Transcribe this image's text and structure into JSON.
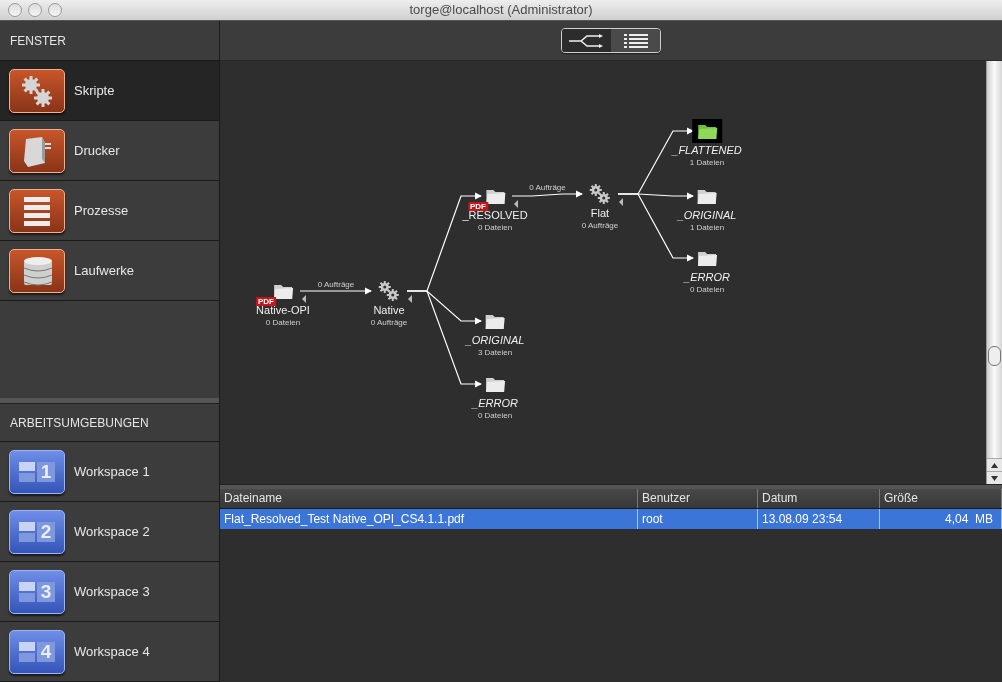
{
  "window": {
    "title": "torge@localhost (Administrator)"
  },
  "sidebar": {
    "sections": [
      {
        "title": "FENSTER",
        "items": [
          {
            "label": "Skripte",
            "kind": "gears",
            "selected": true
          },
          {
            "label": "Drucker",
            "kind": "printer",
            "selected": false
          },
          {
            "label": "Prozesse",
            "kind": "list",
            "selected": false
          },
          {
            "label": "Laufwerke",
            "kind": "disks",
            "selected": false
          }
        ]
      },
      {
        "title": "ARBEITSUMGEBUNGEN",
        "items": [
          {
            "label": "Workspace 1",
            "kind": "workspace",
            "badge": "1",
            "selected": false
          },
          {
            "label": "Workspace 2",
            "kind": "workspace",
            "badge": "2",
            "selected": false
          },
          {
            "label": "Workspace 3",
            "kind": "workspace",
            "badge": "3",
            "selected": false
          },
          {
            "label": "Workspace 4",
            "kind": "workspace",
            "badge": "4",
            "selected": false
          }
        ]
      }
    ]
  },
  "view_switch": [
    {
      "kind": "workflow",
      "selected": true
    },
    {
      "kind": "list",
      "selected": false
    }
  ],
  "workflow": {
    "kind": "folder",
    "name": "Native-OPI",
    "count": "0 Dateien",
    "badge": "PDF",
    "italic": false,
    "highlighted": false,
    "children": [
      {
        "kind": "process",
        "name": "Native",
        "count": "0 Aufträge",
        "edge_label": "0 Aufträge",
        "children": [
          {
            "kind": "folder",
            "name": "_RESOLVED",
            "count": "0 Dateien",
            "badge": "PDF",
            "italic": false,
            "highlighted": false,
            "children": [
              {
                "kind": "process",
                "name": "Flat",
                "count": "0 Aufträge",
                "edge_label": "0 Aufträge",
                "children": [
                  {
                    "kind": "folder",
                    "name": "_FLATTENED",
                    "count": "1 Dateien",
                    "italic": true,
                    "highlighted": true
                  },
                  {
                    "kind": "folder",
                    "name": "_ORIGINAL",
                    "count": "1 Dateien",
                    "italic": true,
                    "highlighted": false
                  },
                  {
                    "kind": "folder",
                    "name": "_ERROR",
                    "count": "0 Dateien",
                    "italic": true,
                    "highlighted": false
                  }
                ]
              }
            ]
          },
          {
            "kind": "folder",
            "name": "_ORIGINAL",
            "count": "3 Dateien",
            "italic": true,
            "highlighted": false
          },
          {
            "kind": "folder",
            "name": "_ERROR",
            "count": "0 Dateien",
            "italic": true,
            "highlighted": false
          }
        ]
      }
    ]
  },
  "table": {
    "columns": [
      "Dateiname",
      "Benutzer",
      "Datum",
      "Größe"
    ],
    "rows": [
      {
        "cells": [
          "Flat_Resolved_Test Native_OPI_CS4.1.1.pdf",
          "root",
          "13.08.09 23:54",
          "4,04  MB"
        ],
        "selected": true
      }
    ]
  }
}
